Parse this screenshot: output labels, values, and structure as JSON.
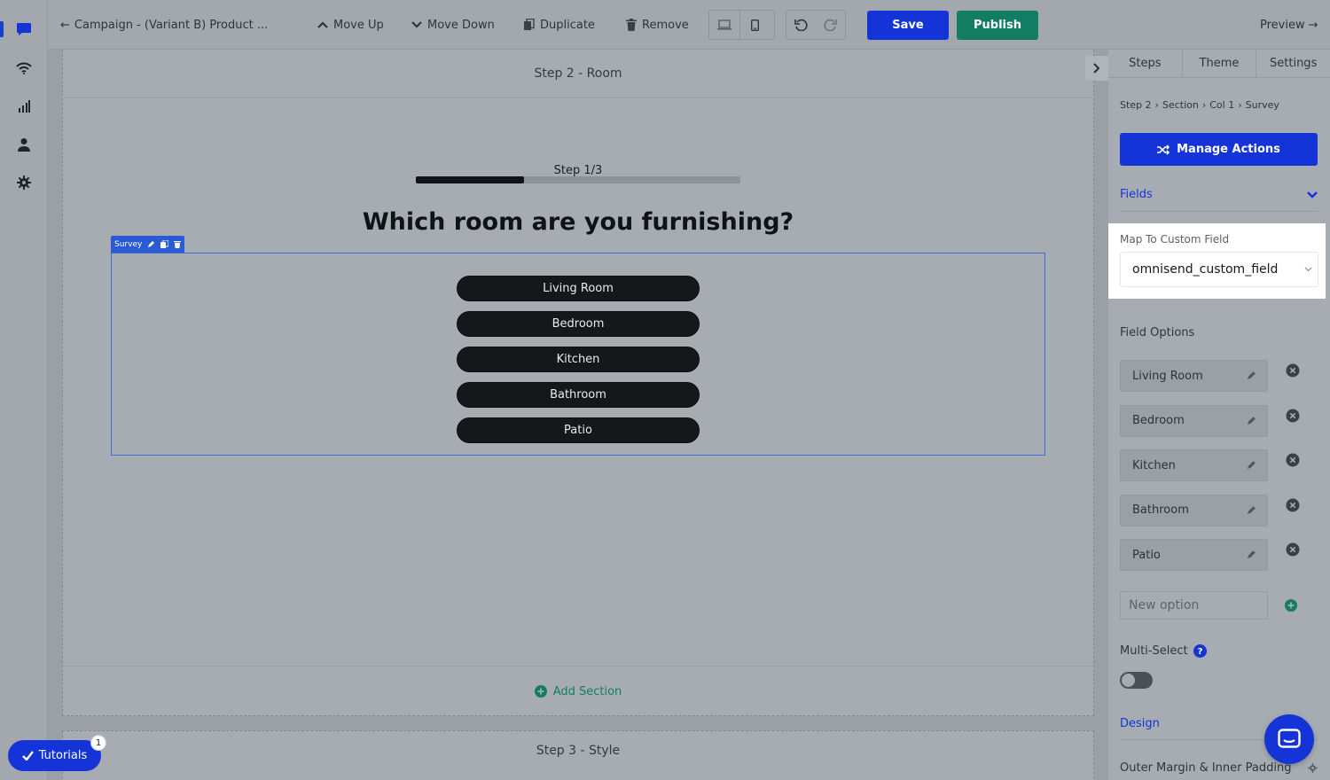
{
  "topbar": {
    "back_label": "Campaign - (Variant B) Product ...",
    "move_up": "Move Up",
    "move_down": "Move Down",
    "duplicate": "Duplicate",
    "remove": "Remove",
    "save": "Save",
    "publish": "Publish",
    "preview": "Preview"
  },
  "leftnav": {
    "icons": [
      "chat-icon",
      "wifi-icon",
      "bar-chart-icon",
      "user-icon",
      "gear-icon"
    ],
    "active_index": 0
  },
  "canvas": {
    "step2_title": "Step 2 - Room",
    "progress": {
      "label": "Step 1/3",
      "current": 1,
      "total": 3
    },
    "question": "Which room are you furnishing?",
    "survey_tag": "Survey",
    "options": [
      "Living Room",
      "Bedroom",
      "Kitchen",
      "Bathroom",
      "Patio"
    ],
    "add_section": "Add Section",
    "step3_title": "Step 3 - Style"
  },
  "panel": {
    "tabs": [
      "Steps",
      "Theme",
      "Settings"
    ],
    "breadcrumb": [
      "Step 2",
      "Section",
      "Col 1",
      "Survey"
    ],
    "manage_actions": "Manage Actions",
    "fields_label": "Fields",
    "map_label": "Map To Custom Field",
    "map_value": "omnisend_custom_field",
    "field_options_label": "Field Options",
    "field_options": [
      "Living Room",
      "Bedroom",
      "Kitchen",
      "Bathroom",
      "Patio"
    ],
    "new_option_placeholder": "New option",
    "multi_select_label": "Multi-Select",
    "multi_select_on": false,
    "design_label": "Design",
    "outer_margin_label": "Outer Margin & Inner Padding"
  },
  "tutorials": {
    "label": "Tutorials",
    "badge": "1"
  },
  "colors": {
    "primary": "#1534d8",
    "success": "#137d63",
    "dark_button": "#15181b"
  }
}
